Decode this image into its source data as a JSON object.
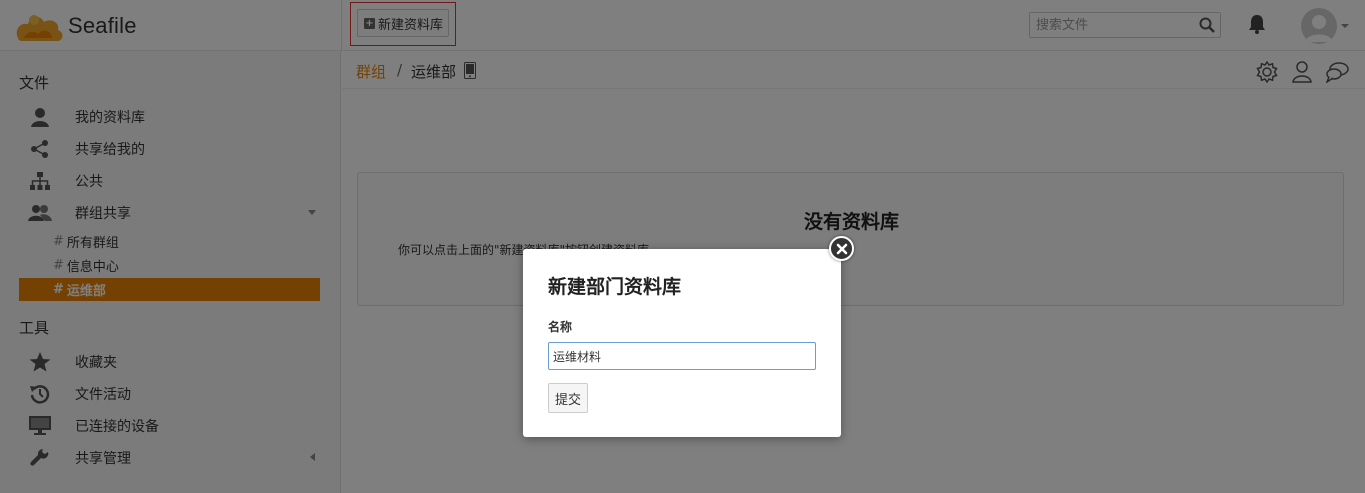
{
  "header": {
    "logo_text": "Seafile",
    "new_library_label": "新建资料库",
    "search_placeholder": "搜索文件"
  },
  "sidebar": {
    "files_heading": "文件",
    "items": [
      {
        "label": "我的资料库",
        "icon": "user-icon"
      },
      {
        "label": "共享给我的",
        "icon": "share-icon"
      },
      {
        "label": "公共",
        "icon": "sitemap-icon"
      },
      {
        "label": "群组共享",
        "icon": "group-icon"
      }
    ],
    "groups": [
      {
        "label": "所有群组",
        "active": false
      },
      {
        "label": "信息中心",
        "active": false
      },
      {
        "label": "运维部",
        "active": true
      }
    ],
    "tools_heading": "工具",
    "tools": [
      {
        "label": "收藏夹",
        "icon": "star-icon"
      },
      {
        "label": "文件活动",
        "icon": "history-icon"
      },
      {
        "label": "已连接的设备",
        "icon": "monitor-icon"
      },
      {
        "label": "共享管理",
        "icon": "wrench-icon"
      }
    ]
  },
  "breadcrumb": {
    "group": "群组",
    "separator": "/",
    "current": "运维部"
  },
  "empty_state": {
    "title": "没有资料库",
    "description": "你可以点击上面的\"新建资料库\"按钮创建资料库。"
  },
  "modal": {
    "title": "新建部门资料库",
    "name_label": "名称",
    "name_value": "运维材料",
    "submit_label": "提交"
  },
  "colors": {
    "accent": "#eb8205",
    "highlight_border": "#e0332c"
  }
}
